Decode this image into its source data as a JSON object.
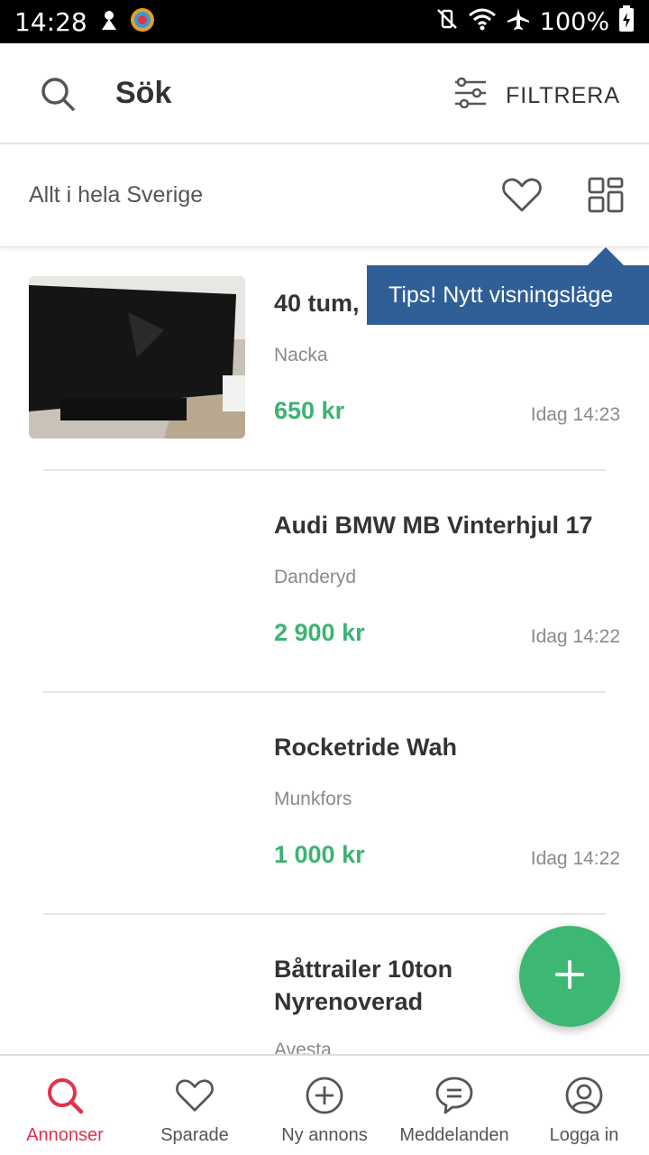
{
  "status_bar": {
    "time": "14:28",
    "battery": "100%"
  },
  "header": {
    "title": "Sök",
    "filter_label": "FILTRERA"
  },
  "subheader": {
    "location": "Allt i hela Sverige"
  },
  "tooltip": {
    "text": "Tips! Nytt visningsläge"
  },
  "listings": [
    {
      "title": "40 tum,",
      "location": "Nacka",
      "price": "650 kr",
      "time": "Idag 14:23",
      "has_image": true
    },
    {
      "title": "Audi BMW MB Vinterhjul 17",
      "location": "Danderyd",
      "price": "2 900 kr",
      "time": "Idag 14:22",
      "has_image": false
    },
    {
      "title": "Rocketride Wah",
      "location": "Munkfors",
      "price": "1 000 kr",
      "time": "Idag 14:22",
      "has_image": false
    },
    {
      "title": "Båttrailer 10ton Nyrenoverad",
      "location": "Avesta",
      "price": "",
      "time": "",
      "has_image": false
    }
  ],
  "bottom_nav": [
    {
      "label": "Annonser",
      "icon": "search-icon",
      "active": true
    },
    {
      "label": "Sparade",
      "icon": "heart-icon",
      "active": false
    },
    {
      "label": "Ny annons",
      "icon": "plus-circle-icon",
      "active": false
    },
    {
      "label": "Meddelanden",
      "icon": "chat-icon",
      "active": false
    },
    {
      "label": "Logga in",
      "icon": "user-icon",
      "active": false
    }
  ],
  "colors": {
    "accent_green": "#3cb371",
    "active_red": "#e0334c",
    "tooltip_blue": "#2f5f96"
  }
}
